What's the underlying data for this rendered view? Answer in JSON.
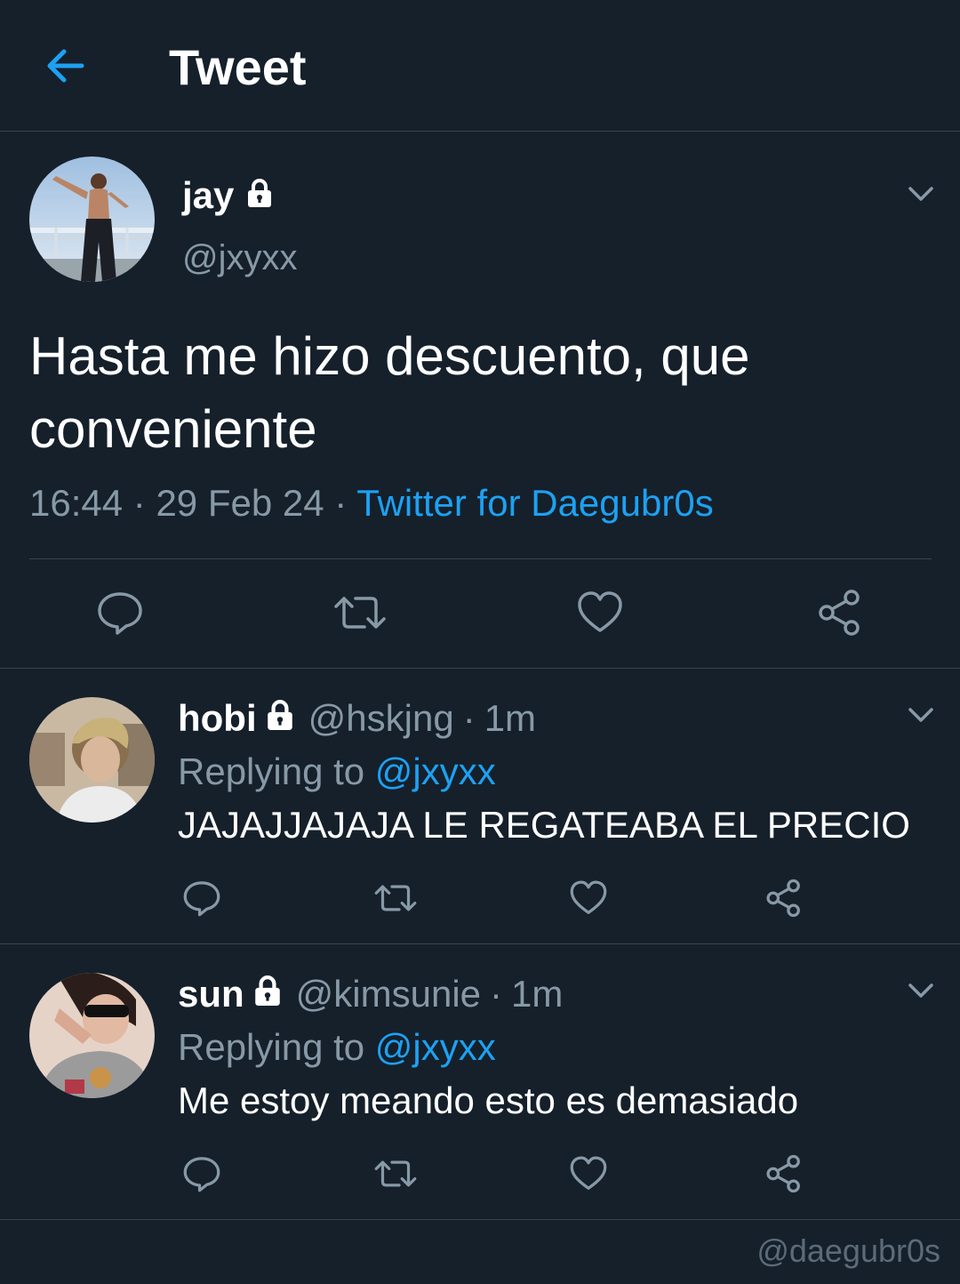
{
  "header": {
    "title": "Tweet",
    "back_icon": "arrow-left-icon"
  },
  "colors": {
    "background": "#15202b",
    "accent": "#1da1f2",
    "muted": "#8899a6",
    "border": "#38444d"
  },
  "main_tweet": {
    "name": "jay",
    "handle": "@jxyxx",
    "text": "Hasta me hizo descuento, que conveniente",
    "time": "16:44",
    "date": "29 Feb 24",
    "source": "Twitter for Daegubr0s",
    "separator": "·"
  },
  "replies": [
    {
      "name": "hobi",
      "handle": "@hskjng",
      "time": "1m",
      "replying_label": "Replying to",
      "replying_handle": "@jxyxx",
      "text": "JAJAJJAJAJA LE REGATEABA EL PRECIO"
    },
    {
      "name": "sun",
      "handle": "@kimsunie",
      "time": "1m",
      "replying_label": "Replying to",
      "replying_handle": "@jxyxx",
      "text": "Me estoy meando esto es demasiado"
    }
  ],
  "watermark": "@daegubr0s"
}
